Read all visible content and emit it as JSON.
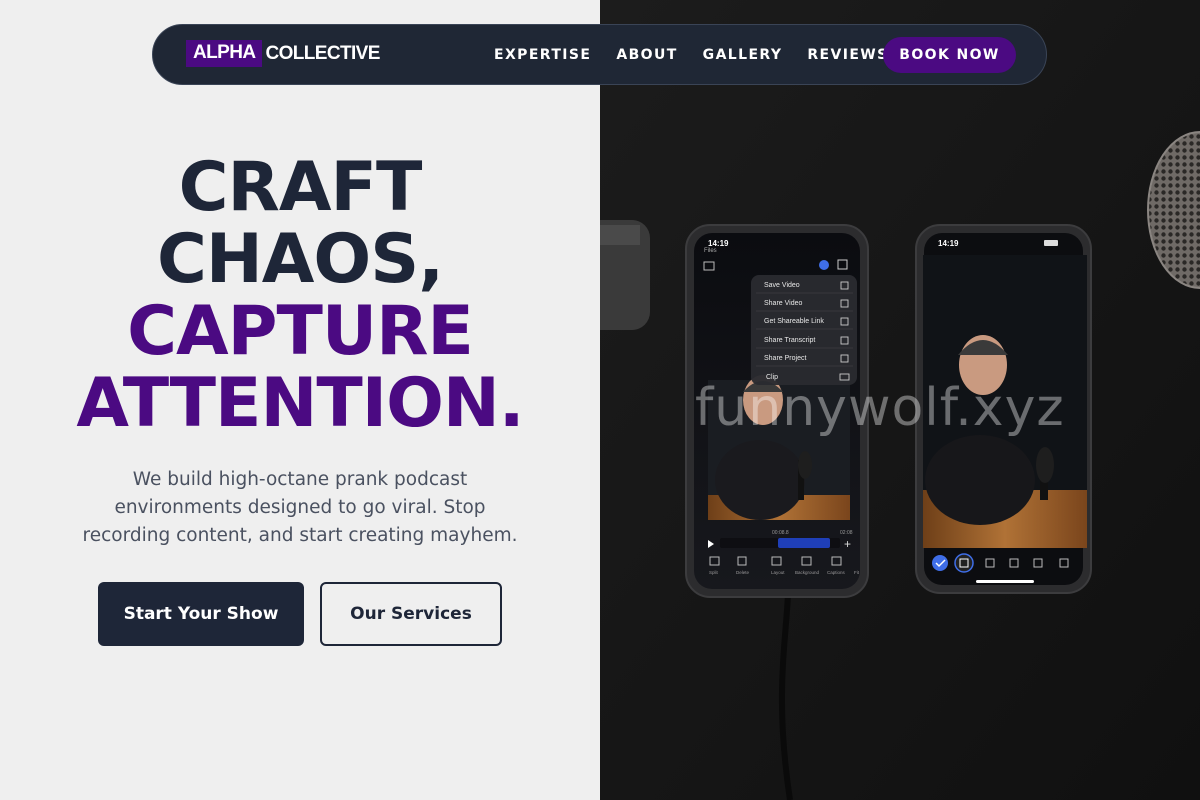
{
  "nav": {
    "logo_mark": "ALPHA",
    "logo_word": "COLLECTIVE",
    "links": [
      "EXPERTISE",
      "ABOUT",
      "GALLERY",
      "REVIEWS"
    ],
    "cta": "BOOK NOW"
  },
  "hero": {
    "title_lines": [
      "CRAFT",
      "CHAOS,",
      "CAPTURE",
      "ATTENTION."
    ],
    "subtitle": "We build high-octane prank podcast environments designed to go viral. Stop recording content, and start creating mayhem.",
    "primary_button": "Start Your Show",
    "secondary_button": "Our Services"
  },
  "photo": {
    "watermark": "funnywolf.xyz",
    "phone_left": {
      "time": "14:19",
      "back_label": "Files",
      "menu_items": [
        "Save Video",
        "Share Video",
        "Get Shareable Link",
        "Share Transcript",
        "Share Project",
        "Clip"
      ],
      "timeline_start": "00:08.8",
      "timeline_end": "02:08",
      "toolbar": [
        "Split",
        "Delete",
        "Layout",
        "Background",
        "Captions",
        "Fit"
      ]
    },
    "phone_right": {
      "time": "14:19"
    }
  },
  "colors": {
    "accent_purple": "#4b0a82",
    "navy": "#1e2638",
    "nav_bg": "#1f2735",
    "left_bg": "#efefef",
    "photo_bg": "#151515"
  }
}
